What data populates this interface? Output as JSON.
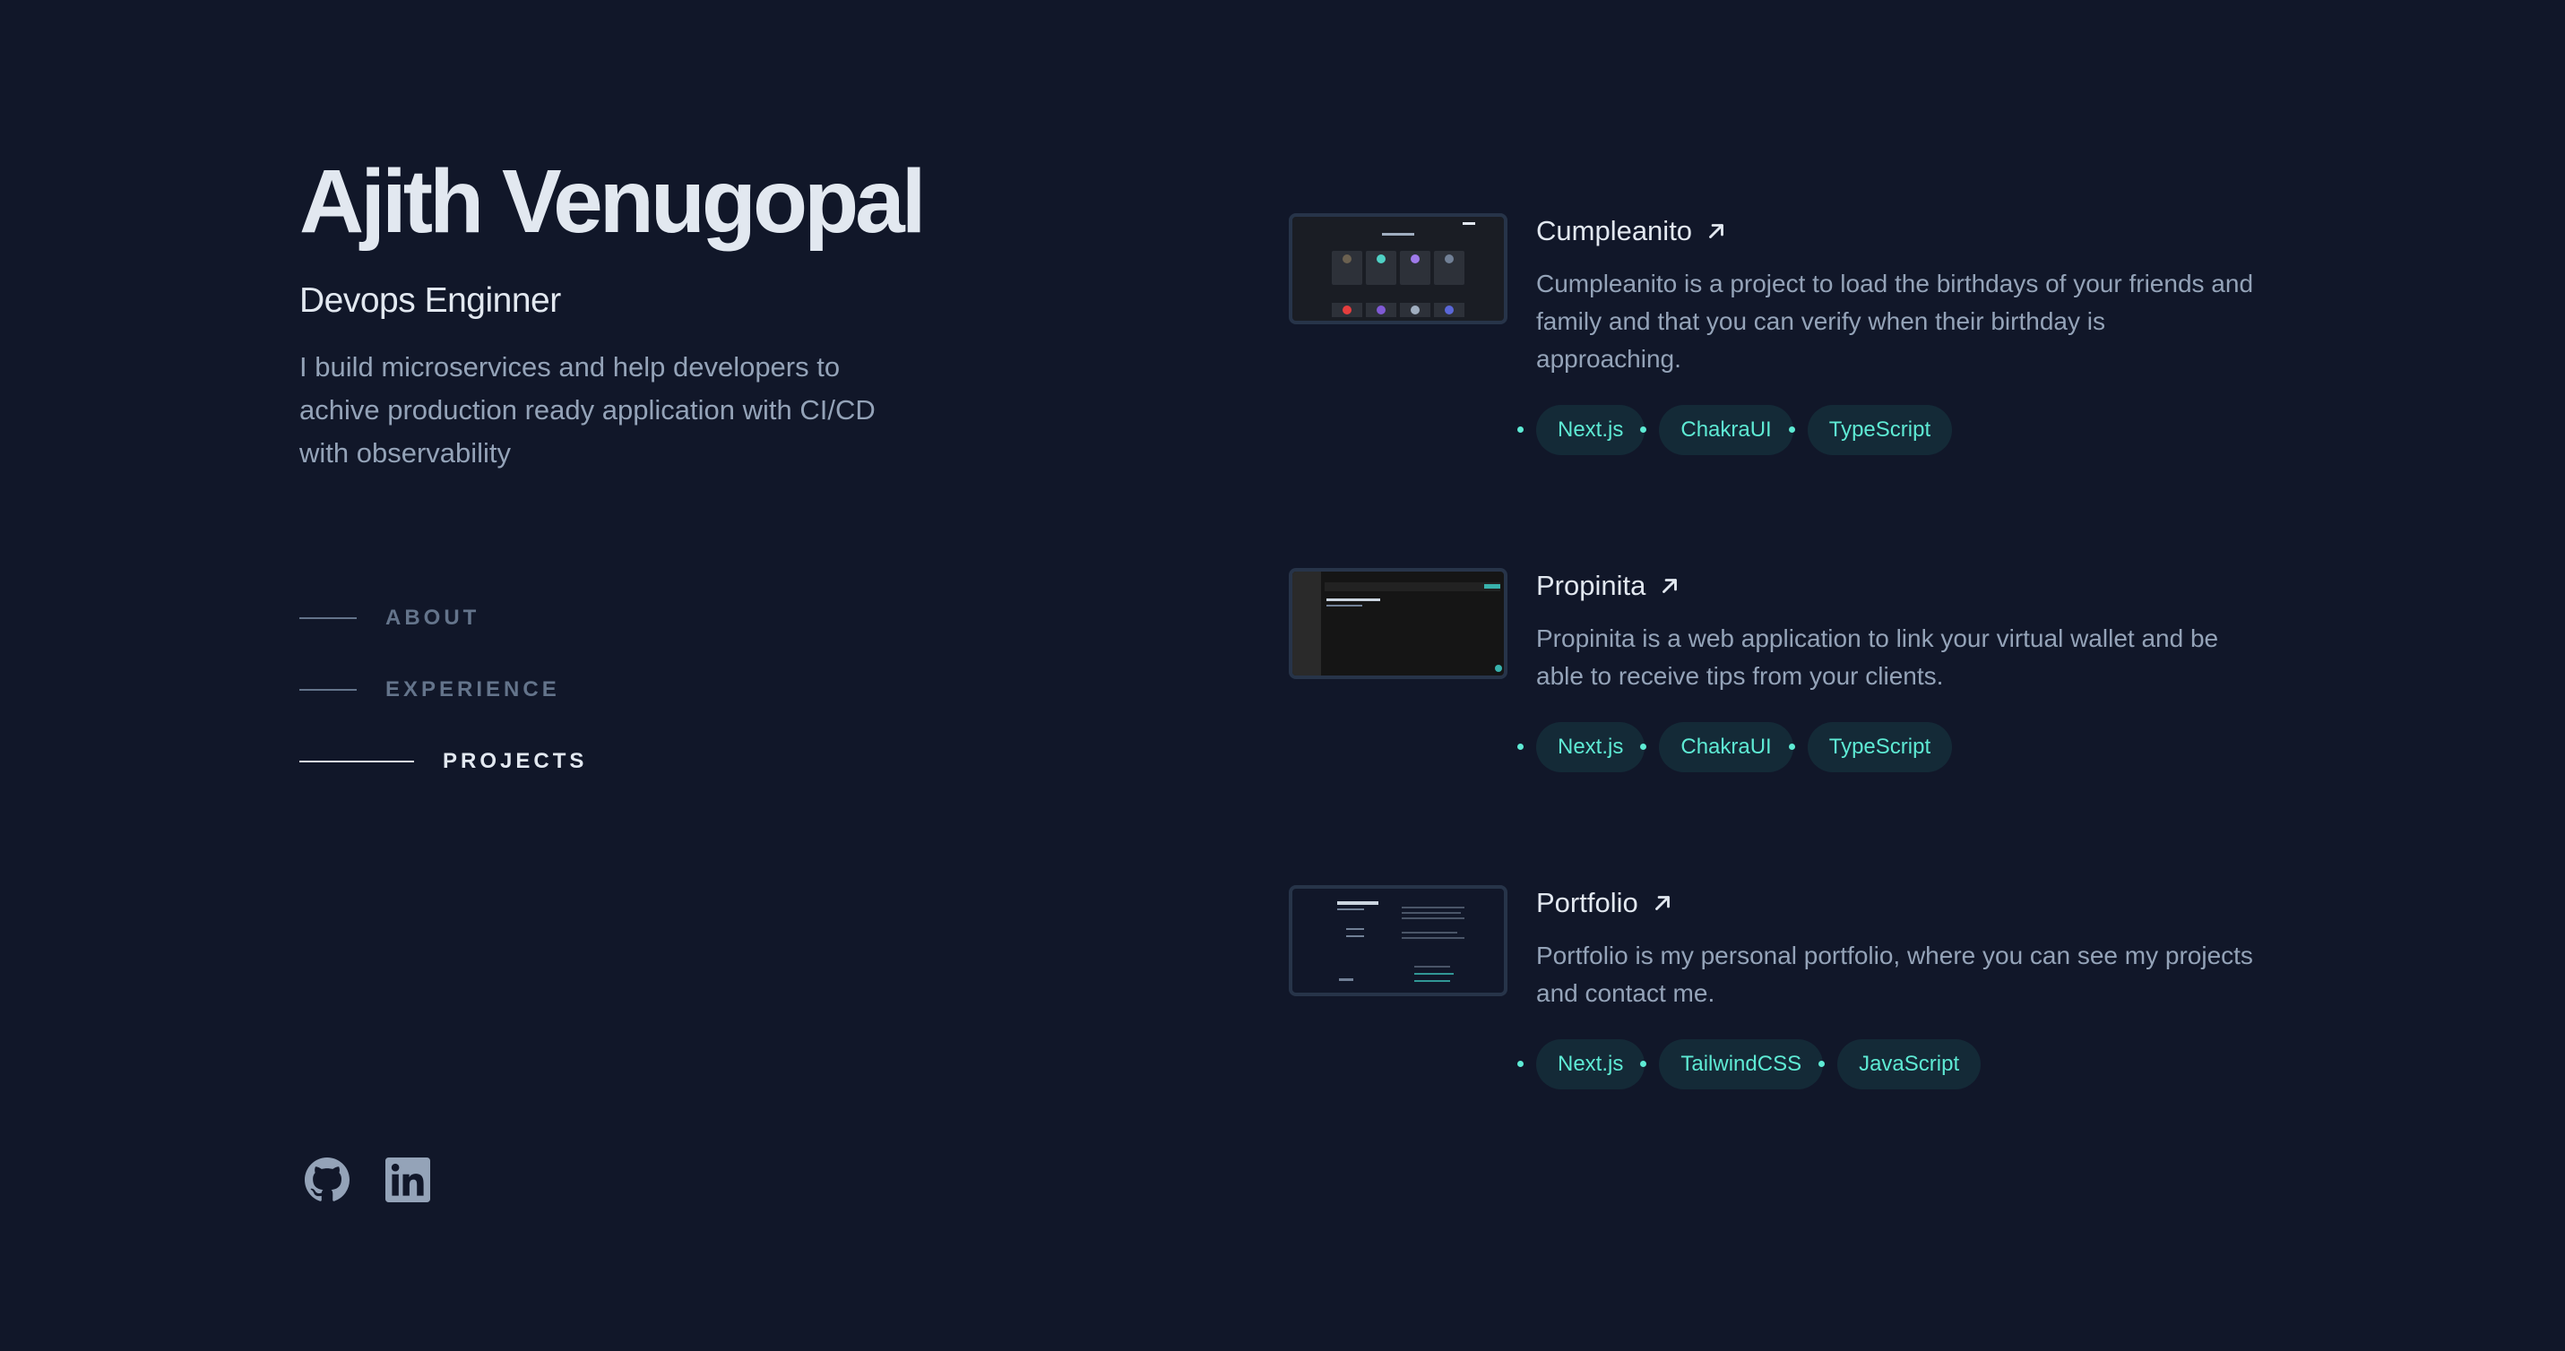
{
  "header": {
    "name": "Ajith Venugopal",
    "role": "Devops Enginner",
    "bio": "I build microservices and help developers to achive production ready application with CI/CD with observability"
  },
  "nav": [
    {
      "label": "ABOUT",
      "active": false
    },
    {
      "label": "EXPERIENCE",
      "active": false
    },
    {
      "label": "PROJECTS",
      "active": true
    }
  ],
  "socials": [
    {
      "icon": "github-icon"
    },
    {
      "icon": "linkedin-icon"
    }
  ],
  "projects": [
    {
      "title": "Cumpleanito",
      "description": "Cumpleanito is a project to load the birthdays of your friends and family and that you can verify when their birthday is approaching.",
      "tags": [
        "Next.js",
        "ChakraUI",
        "TypeScript"
      ]
    },
    {
      "title": "Propinita",
      "description": "Propinita is a web application to link your virtual wallet and be able to receive tips from your clients.",
      "tags": [
        "Next.js",
        "ChakraUI",
        "TypeScript"
      ]
    },
    {
      "title": "Portfolio",
      "description": "Portfolio is my personal portfolio, where you can see my projects and contact me.",
      "tags": [
        "Next.js",
        "TailwindCSS",
        "JavaScript"
      ]
    }
  ],
  "colors": {
    "background": "#111729",
    "heading": "#e2e8f0",
    "body": "#94a3b8",
    "muted": "#64748b",
    "tag_text": "#5eead4",
    "thumb_border": "#273449"
  }
}
